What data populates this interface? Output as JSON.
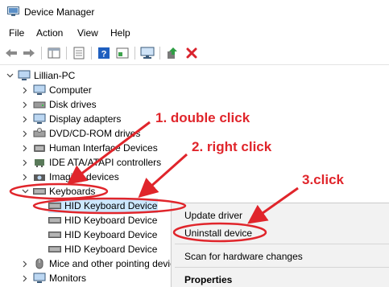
{
  "window": {
    "title": "Device Manager"
  },
  "menu": [
    "File",
    "Action",
    "View",
    "Help"
  ],
  "tree": {
    "root": "Lillian-PC",
    "items": [
      "Computer",
      "Disk drives",
      "Display adapters",
      "DVD/CD-ROM drives",
      "Human Interface Devices",
      "IDE ATA/ATAPI controllers",
      "Imaging devices",
      "Keyboards",
      "Mice and other pointing devices",
      "Monitors"
    ],
    "keyboards": [
      "HID Keyboard Device",
      "HID Keyboard Device",
      "HID Keyboard Device",
      "HID Keyboard Device"
    ]
  },
  "context_menu": {
    "update": "Update driver",
    "uninstall": "Uninstall device",
    "scan": "Scan for hardware changes",
    "properties": "Properties"
  },
  "annotations": {
    "step1": "1. double click",
    "step2": "2. right click",
    "step3": "3.click"
  },
  "colors": {
    "annotation": "#e0252b",
    "selection": "#cce8ff",
    "delete_x": "#d9232d",
    "help_blue": "#1f5fbf"
  }
}
